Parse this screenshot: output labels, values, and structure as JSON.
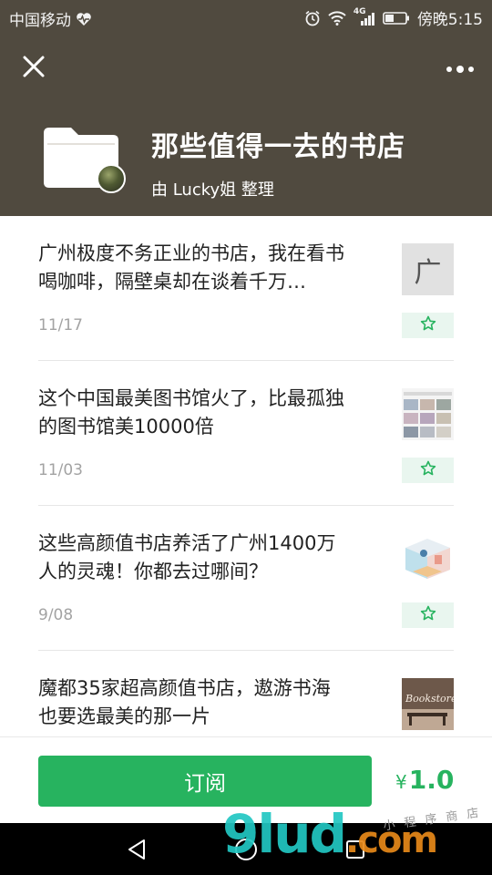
{
  "status_bar": {
    "carrier": "中国移动",
    "network": "4G",
    "time": "傍晚5:15"
  },
  "header": {
    "title": "那些值得一去的书店",
    "curator": "由 Lucky姐 整理"
  },
  "articles": [
    {
      "title": "广州极度不务正业的书店，我在看书喝咖啡，隔壁桌却在谈着千万…",
      "date": "11/17",
      "thumb_text": "广"
    },
    {
      "title": "这个中国最美图书馆火了，比最孤独的图书馆美10000倍",
      "date": "11/03"
    },
    {
      "title": "这些高颜值书店养活了广州1400万人的灵魂！你都去过哪间？",
      "date": "9/08"
    },
    {
      "title": "魔都35家超高颜值书店，遨游书海也要选最美的那一片",
      "thumb_text": "Bookstore"
    }
  ],
  "bottom": {
    "subscribe_label": "订阅",
    "currency": "¥",
    "price": "1.0"
  },
  "watermark": {
    "logo": "9lud",
    "suffix": ".com",
    "small": "小 程 序 商 店"
  },
  "colors": {
    "header_bg": "#504a3f",
    "accent_green": "#27b35f",
    "star_bg": "#e9f6ef"
  }
}
